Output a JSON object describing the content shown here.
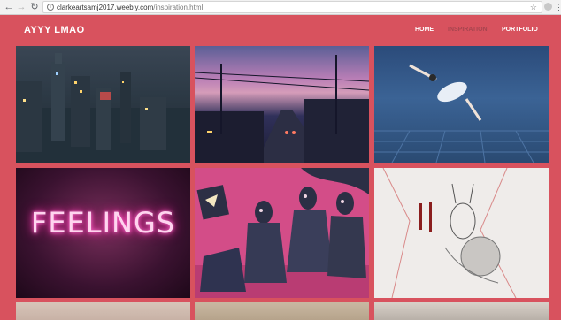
{
  "browser": {
    "url_domain": "clarkeartsamj2017.weebly.com",
    "url_path": "/inspiration.html"
  },
  "site": {
    "title": "AYYY LMAO",
    "nav": [
      {
        "label": "HOME",
        "active": false
      },
      {
        "label": "INSPIRATION",
        "active": true
      },
      {
        "label": "PORTFOLIO",
        "active": false
      }
    ]
  },
  "gallery": {
    "neon_sign_text": "FEELINGS"
  },
  "colors": {
    "page_background": "#d8525e",
    "active_nav": "#a8454f"
  },
  "icons": [
    "back-arrow-icon",
    "forward-arrow-icon",
    "reload-icon",
    "info-icon",
    "star-icon",
    "extension-icon",
    "menu-icon"
  ]
}
